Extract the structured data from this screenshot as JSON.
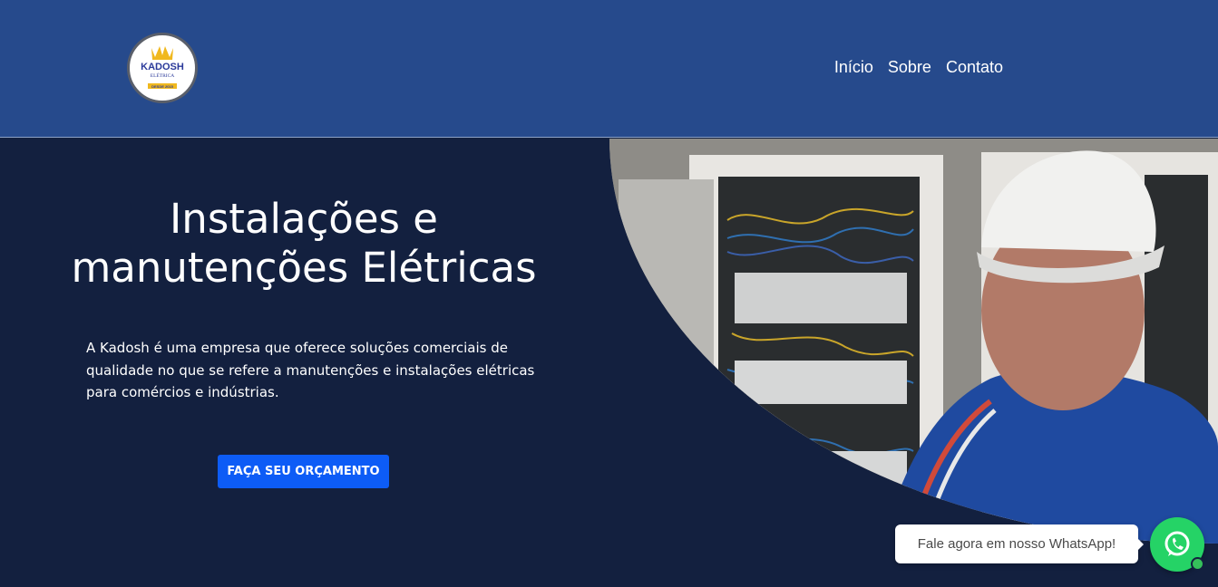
{
  "colors": {
    "header_bg": "#264a8c",
    "hero_bg": "#13203f",
    "cta_bg": "#0d5cf6",
    "whatsapp_green": "#25d366"
  },
  "header": {
    "logo": {
      "icon": "crown-logo",
      "brand": "KADOSH",
      "sub": "ELÉTRICA",
      "since": "DESDE 2015"
    },
    "nav": [
      "Início",
      "Sobre",
      "Contato"
    ]
  },
  "hero": {
    "title_line1": "Instalações e",
    "title_line2": "manutenções Elétricas",
    "description": "A Kadosh é uma empresa que oferece soluções comerciais de qualidade no que se refere a manutenções e instalações elétricas para comércios e indústrias.",
    "cta_label": "FAÇA SEU ORÇAMENTO",
    "image_icon": "electrician-photo"
  },
  "whatsapp": {
    "bubble_text": "Fale agora em nosso WhatsApp!",
    "icon": "whatsapp-icon"
  }
}
